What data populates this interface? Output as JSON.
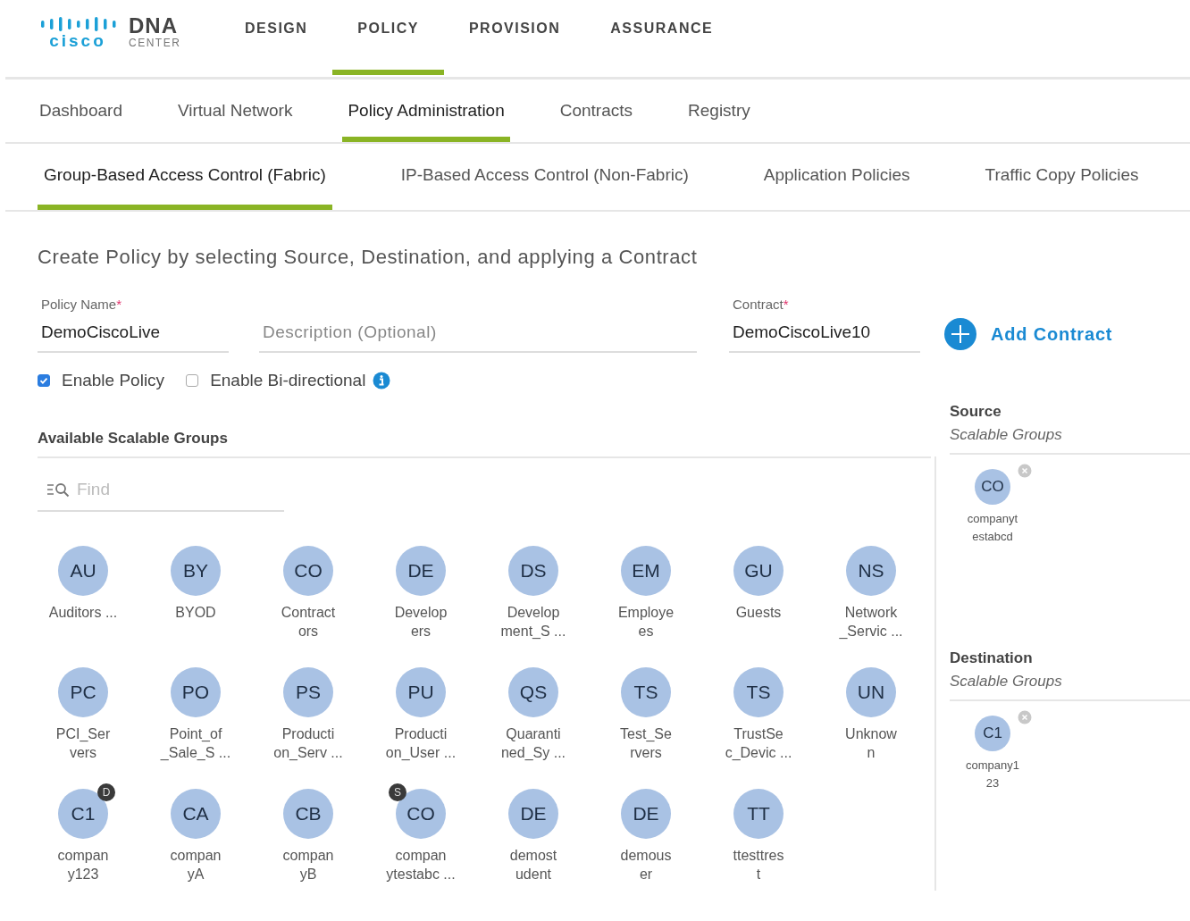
{
  "brand": {
    "logo_text": "cisco",
    "product": "DNA",
    "product_sub": "CENTER"
  },
  "top_nav": [
    {
      "label": "DESIGN",
      "selected": false
    },
    {
      "label": "POLICY",
      "selected": true
    },
    {
      "label": "PROVISION",
      "selected": false
    },
    {
      "label": "ASSURANCE",
      "selected": false
    }
  ],
  "sub_nav": [
    {
      "label": "Dashboard",
      "selected": false
    },
    {
      "label": "Virtual Network",
      "selected": false
    },
    {
      "label": "Policy Administration",
      "selected": true
    },
    {
      "label": "Contracts",
      "selected": false
    },
    {
      "label": "Registry",
      "selected": false
    }
  ],
  "tabs": [
    {
      "label": "Group-Based Access Control (Fabric)",
      "selected": true
    },
    {
      "label": "IP-Based Access Control (Non-Fabric)",
      "selected": false
    },
    {
      "label": "Application Policies",
      "selected": false
    },
    {
      "label": "Traffic Copy Policies",
      "selected": false
    }
  ],
  "heading": "Create Policy by selecting Source, Destination, and applying a Contract",
  "form": {
    "policy_name": {
      "label": "Policy Name",
      "required_mark": "*",
      "value": "DemoCiscoLive"
    },
    "description": {
      "placeholder": "Description (Optional)"
    },
    "contract": {
      "label": "Contract",
      "required_mark": "*",
      "value": "DemoCiscoLive10"
    },
    "add_contract": "Add Contract",
    "checkboxes": [
      {
        "label": "Enable Policy",
        "checked": true,
        "info": false
      },
      {
        "label": "Enable Bi-directional",
        "checked": false,
        "info": true
      }
    ]
  },
  "available": {
    "title": "Available Scalable Groups",
    "search": {
      "placeholder": "Find"
    },
    "groups": [
      {
        "abbr": "AU",
        "lines": [
          "Auditors ..."
        ]
      },
      {
        "abbr": "BY",
        "lines": [
          "BYOD"
        ]
      },
      {
        "abbr": "CO",
        "lines": [
          "Contract",
          "ors"
        ]
      },
      {
        "abbr": "DE",
        "lines": [
          "Develop",
          "ers"
        ]
      },
      {
        "abbr": "DS",
        "lines": [
          "Develop",
          "ment_S ..."
        ]
      },
      {
        "abbr": "EM",
        "lines": [
          "Employe",
          "es"
        ]
      },
      {
        "abbr": "GU",
        "lines": [
          "Guests"
        ]
      },
      {
        "abbr": "NS",
        "lines": [
          "Network",
          "_Servic ..."
        ]
      },
      {
        "abbr": "PC",
        "lines": [
          "PCI_Ser",
          "vers"
        ]
      },
      {
        "abbr": "PO",
        "lines": [
          "Point_of",
          "_Sale_S ..."
        ]
      },
      {
        "abbr": "PS",
        "lines": [
          "Producti",
          "on_Serv ..."
        ]
      },
      {
        "abbr": "PU",
        "lines": [
          "Producti",
          "on_User ..."
        ]
      },
      {
        "abbr": "QS",
        "lines": [
          "Quaranti",
          "ned_Sy ..."
        ]
      },
      {
        "abbr": "TS",
        "lines": [
          "Test_Se",
          "rvers"
        ]
      },
      {
        "abbr": "TS",
        "lines": [
          "TrustSe",
          "c_Devic ..."
        ]
      },
      {
        "abbr": "UN",
        "lines": [
          "Unknow",
          "n"
        ]
      },
      {
        "abbr": "C1",
        "lines": [
          "compan",
          "y123"
        ],
        "badge": {
          "text": "D",
          "on_left": false
        }
      },
      {
        "abbr": "CA",
        "lines": [
          "compan",
          "yA"
        ]
      },
      {
        "abbr": "CB",
        "lines": [
          "compan",
          "yB"
        ]
      },
      {
        "abbr": "CO",
        "lines": [
          "compan",
          "ytestabc ..."
        ],
        "badge": {
          "text": "S",
          "on_left": true
        }
      },
      {
        "abbr": "DE",
        "lines": [
          "demost",
          "udent"
        ]
      },
      {
        "abbr": "DE",
        "lines": [
          "demous",
          "er"
        ]
      },
      {
        "abbr": "TT",
        "lines": [
          "ttesttres",
          "t"
        ]
      }
    ]
  },
  "source": {
    "title": "Source",
    "subtitle": "Scalable Groups",
    "groups": [
      {
        "abbr": "CO",
        "lines": [
          "companyt",
          "estabcd"
        ]
      }
    ]
  },
  "destination": {
    "title": "Destination",
    "subtitle": "Scalable Groups",
    "groups": [
      {
        "abbr": "C1",
        "lines": [
          "company1",
          "23"
        ]
      }
    ]
  }
}
